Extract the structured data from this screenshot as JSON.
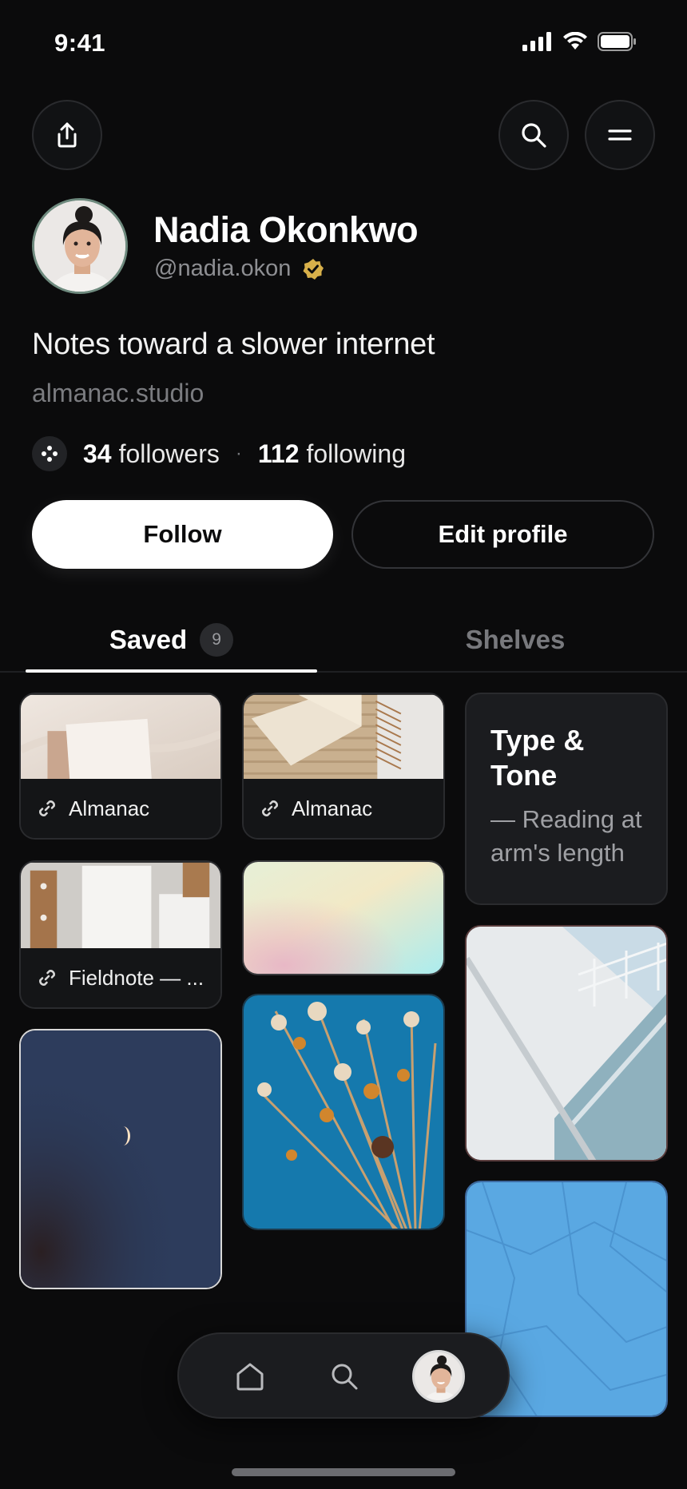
{
  "status_bar": {
    "time": "9:41"
  },
  "header": {
    "share_icon": "share-icon",
    "search_icon": "search-icon",
    "menu_icon": "menu-icon"
  },
  "profile": {
    "name": "Nadia Okonkwo",
    "handle": "@nadia.okon",
    "verified": true,
    "bio": "Notes toward a slower internet",
    "website": "almanac.studio",
    "followers_count": "34",
    "followers_label": "followers",
    "following_count": "112",
    "following_label": "following",
    "separator": "·"
  },
  "actions": {
    "follow_label": "Follow",
    "edit_label": "Edit profile"
  },
  "tabs": {
    "saved_label": "Saved",
    "saved_count": "9",
    "shelves_label": "Shelves"
  },
  "grid": {
    "link1_label": "Almanac",
    "link2_label": "Almanac",
    "link3_label": "Fieldnote — ...",
    "note_title_line1": "Type &",
    "note_title_line2": "Tone",
    "note_body": "— Reading at arm's length"
  },
  "colors": {
    "background": "#0b0b0c",
    "verified_badge": "#d8b04a",
    "muted_text": "#8e8f93"
  }
}
